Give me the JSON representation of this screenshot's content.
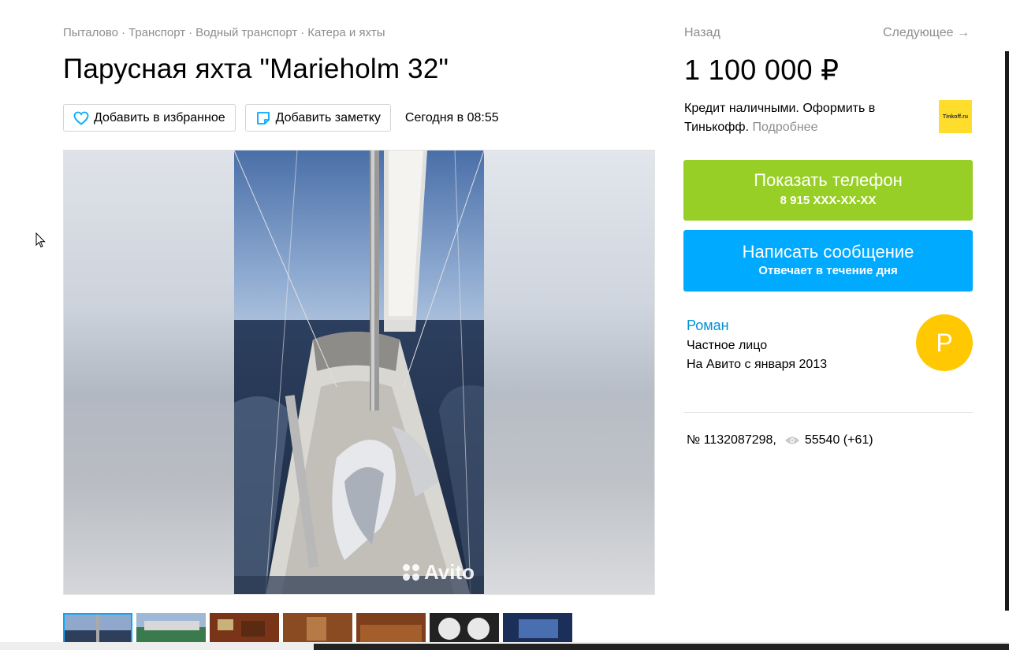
{
  "breadcrumb": {
    "items": [
      "Пыталово",
      "Транспорт",
      "Водный транспорт",
      "Катера и яхты"
    ],
    "separator": "·"
  },
  "listing": {
    "title": "Парусная яхта \"Marieholm 32\"",
    "favorite_label": "Добавить в избранное",
    "note_label": "Добавить заметку",
    "posted": "Сегодня в 08:55",
    "photo_count_thumbs": 7
  },
  "gallery": {
    "watermark": "Avito"
  },
  "nav": {
    "back": "Назад",
    "next": "Следующее →"
  },
  "price": "1 100 000 ₽",
  "credit": {
    "text": "Кредит наличными. Оформить в Тинькофф.",
    "more": "Подробнее",
    "logo": "Tinkoff.ru"
  },
  "buttons": {
    "phone_title": "Показать телефон",
    "phone_number": "8 915 XXX-XX-XX",
    "message_title": "Написать сообщение",
    "message_sub": "Отвечает в течение дня"
  },
  "seller": {
    "name": "Роман",
    "type": "Частное лицо",
    "since": "На Авито с января 2013",
    "avatar_letter": "Р"
  },
  "meta": {
    "id": "№ 1132087298,",
    "views": "55540 (+61)"
  },
  "colors": {
    "green": "#97cf26",
    "blue": "#00aaff",
    "link": "#0091d9",
    "avatar": "#ffc800",
    "tinkoff": "#ffdd2d"
  }
}
